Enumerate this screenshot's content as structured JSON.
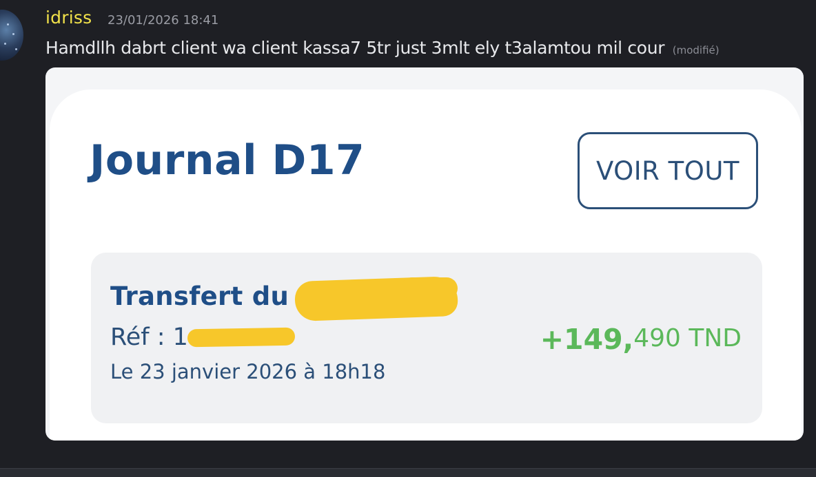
{
  "message": {
    "username": "idriss",
    "timestamp": "23/01/2026 18:41",
    "text": "Hamdllh dabrt client wa client kassa7 5tr just 3mlt ely t3alamtou mil cour",
    "edited_label": "(modifié)",
    "username_color": "#f2e24a"
  },
  "attachment": {
    "journal_title": "Journal D17",
    "voir_tout_label": "VOIR TOUT",
    "transaction": {
      "title": "Transfert du",
      "reference": "Réf : 1",
      "date": "Le 23 janvier 2026 à 18h18",
      "amount_main": "+149,",
      "amount_rest": "490 TND",
      "amount_color": "#5bb85a"
    },
    "redaction_color": "#f7c72a",
    "title_color": "#1f4e87"
  }
}
